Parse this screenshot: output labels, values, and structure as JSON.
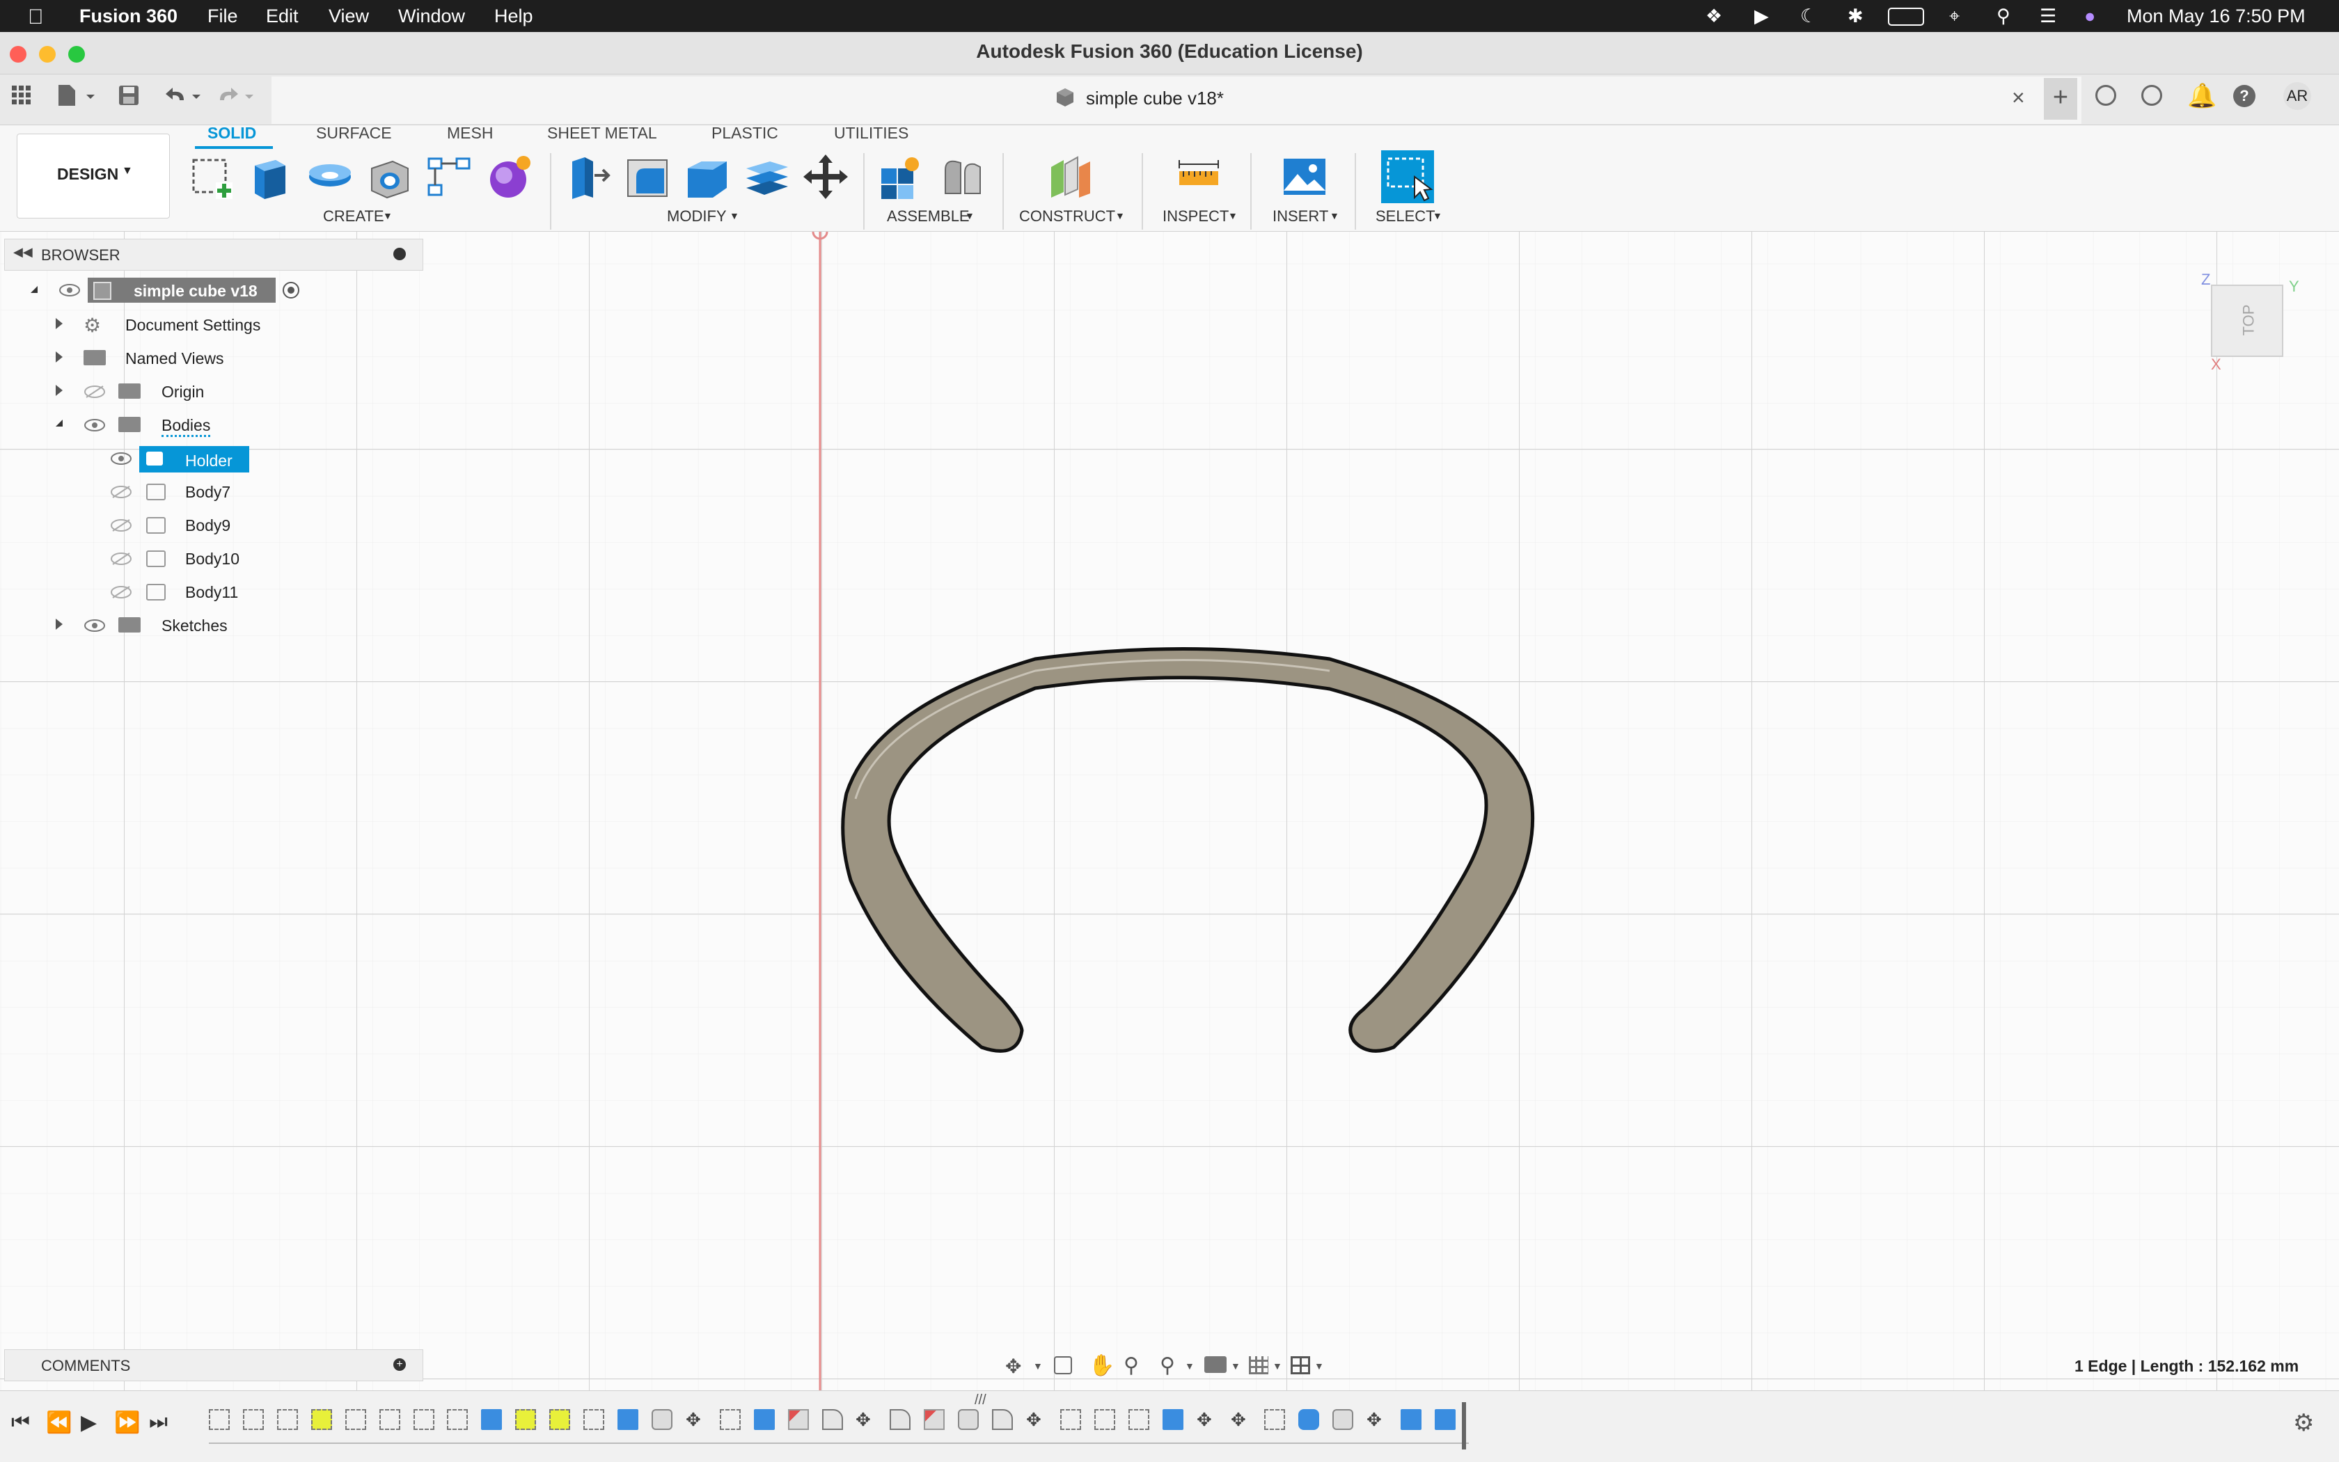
{
  "menubar": {
    "app_name": "Fusion 360",
    "items": [
      "File",
      "Edit",
      "View",
      "Window",
      "Help"
    ],
    "clock": "Mon May 16  7:50 PM"
  },
  "window": {
    "title": "Autodesk Fusion 360 (Education License)",
    "doc_tab": "simple cube v18*",
    "user_initials": "AR"
  },
  "ribbon": {
    "workspace": "DESIGN",
    "tabs": [
      "SOLID",
      "SURFACE",
      "MESH",
      "SHEET METAL",
      "PLASTIC",
      "UTILITIES"
    ],
    "active_tab": "SOLID",
    "groups": [
      "CREATE",
      "MODIFY",
      "ASSEMBLE",
      "CONSTRUCT",
      "INSPECT",
      "INSERT",
      "SELECT"
    ]
  },
  "browser": {
    "title": "BROWSER",
    "root": "simple cube v18",
    "nodes": [
      "Document Settings",
      "Named Views",
      "Origin",
      "Bodies",
      "Holder",
      "Body7",
      "Body9",
      "Body10",
      "Body11",
      "Sketches"
    ]
  },
  "viewcube": {
    "face": "TOP",
    "axis_z": "Z",
    "axis_y": "Y",
    "axis_x": "X"
  },
  "comments": {
    "title": "COMMENTS"
  },
  "status": {
    "selection": "1 Edge | Length : 152.162 mm"
  },
  "colors": {
    "accent": "#0696d7",
    "body": "#9c9482",
    "highlight": "#e8f03a"
  }
}
